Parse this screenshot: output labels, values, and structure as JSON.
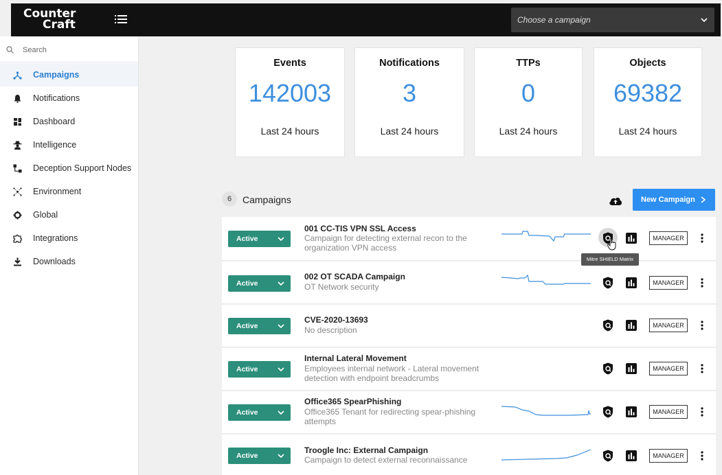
{
  "header": {
    "logo_line1": "Counter",
    "logo_line2": "Craft",
    "campaign_select_placeholder": "Choose a campaign"
  },
  "sidebar": {
    "search_placeholder": "Search",
    "items": [
      {
        "label": "Campaigns",
        "icon": "campaigns-icon",
        "active": true
      },
      {
        "label": "Notifications",
        "icon": "bell-icon"
      },
      {
        "label": "Dashboard",
        "icon": "dashboard-icon"
      },
      {
        "label": "Intelligence",
        "icon": "spy-icon"
      },
      {
        "label": "Deception Support Nodes",
        "icon": "nodes-icon"
      },
      {
        "label": "Environment",
        "icon": "network-icon"
      },
      {
        "label": "Global",
        "icon": "gear-icon"
      },
      {
        "label": "Integrations",
        "icon": "puzzle-icon"
      },
      {
        "label": "Downloads",
        "icon": "download-icon"
      }
    ]
  },
  "stats": [
    {
      "title": "Events",
      "value": "142003",
      "subtitle": "Last 24 hours"
    },
    {
      "title": "Notifications",
      "value": "3",
      "subtitle": "Last 24 hours"
    },
    {
      "title": "TTPs",
      "value": "0",
      "subtitle": "Last 24 hours"
    },
    {
      "title": "Objects",
      "value": "69382",
      "subtitle": "Last 24 hours"
    }
  ],
  "campaigns": {
    "count": "6",
    "title": "Campaigns",
    "new_button_label": "New Campaign",
    "tooltip": "Mitre SHIELD Matrix",
    "rows": [
      {
        "status": "Active",
        "name": "001 CC-TIS VPN SSL Access",
        "description": "Campaign for detecting external recon to the organization VPN access",
        "manager_label": "MANAGER",
        "sparkline": "step-dip"
      },
      {
        "status": "Active",
        "name": "002 OT SCADA Campaign",
        "description": "OT Network security",
        "manager_label": "MANAGER",
        "sparkline": "step-down"
      },
      {
        "status": "Active",
        "name": "CVE-2020-13693",
        "description": "No description",
        "manager_label": "MANAGER",
        "sparkline": "none"
      },
      {
        "status": "Active",
        "name": "Internal Lateral Movement",
        "description": "Employees internal network - Lateral movement detection with endpoint breadcrumbs",
        "manager_label": "MANAGER",
        "sparkline": "none"
      },
      {
        "status": "Active",
        "name": "Office365 SpearPhishing",
        "description": "Office365 Tenant for redirecting spear-phishing attempts",
        "manager_label": "MANAGER",
        "sparkline": "drop-flat-rise"
      },
      {
        "status": "Active",
        "name": "Troogle Inc: External Campaign",
        "description": "Campaign to detect external reconnaissance",
        "manager_label": "MANAGER",
        "sparkline": "rising"
      }
    ]
  },
  "colors": {
    "accent": "#3d8fde",
    "status_active": "#2b8f7b",
    "topbar": "#111111",
    "new_button": "#2d8ff0"
  }
}
